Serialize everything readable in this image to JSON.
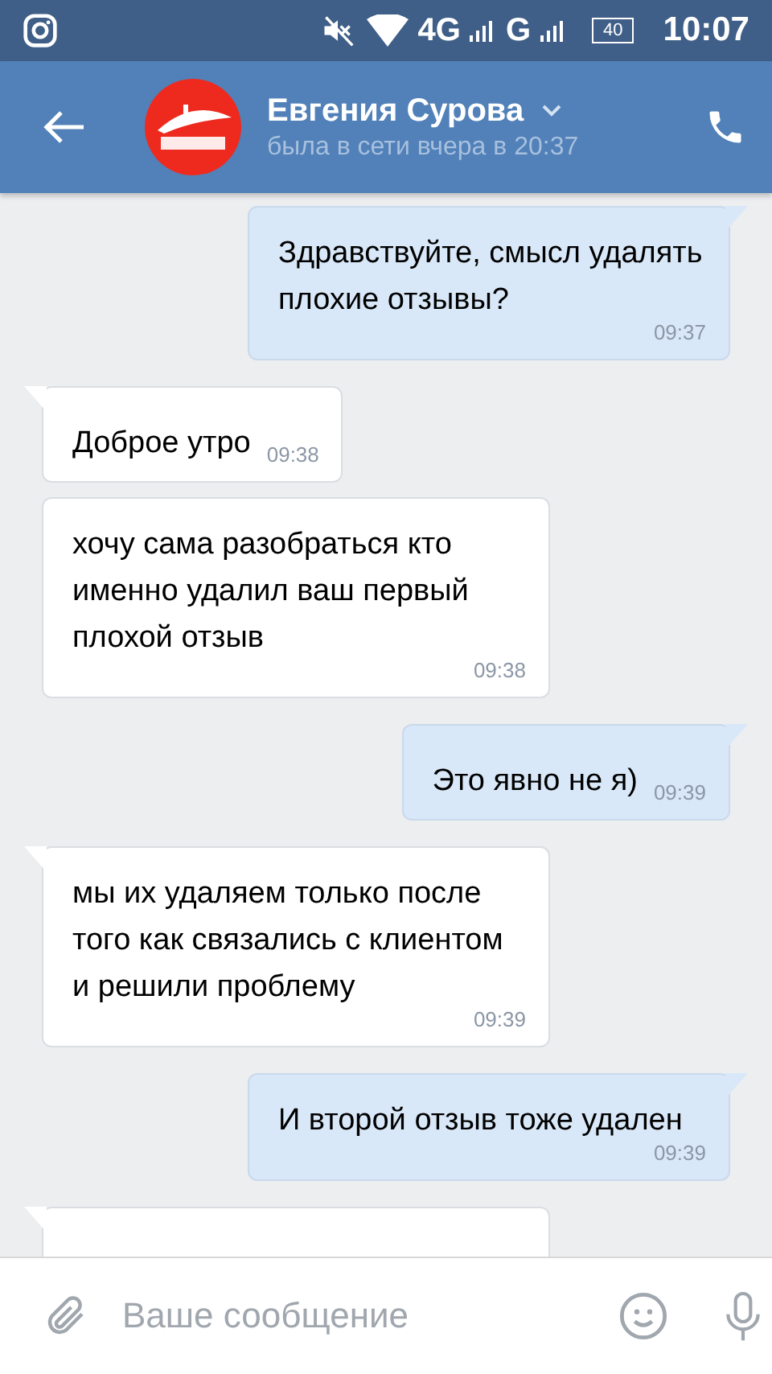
{
  "status_bar": {
    "network_1": "4G",
    "network_2": "G",
    "battery": "40",
    "time": "10:07"
  },
  "header": {
    "name": "Евгения Сурова",
    "status": "была в сети вчера в 20:37"
  },
  "messages": [
    {
      "kind": "out",
      "tail": true,
      "text": "Здравствуйте, смысл удалять плохие отзывы?",
      "time": "09:37"
    },
    {
      "kind": "in",
      "tail": true,
      "text": "Доброе утро",
      "time": "09:38"
    },
    {
      "kind": "in",
      "tail": false,
      "text": "хочу сама разобраться кто именно удалил ваш первый плохой отзыв",
      "time": "09:38"
    },
    {
      "kind": "out",
      "tail": true,
      "text": "Это явно не я)",
      "time": "09:39"
    },
    {
      "kind": "in",
      "tail": true,
      "text": "мы их удаляем только после того как связались с клиентом и решили проблему",
      "time": "09:39"
    },
    {
      "kind": "out",
      "tail": true,
      "text": "И второй отзыв тоже удален",
      "time": "09:39"
    },
    {
      "kind": "in",
      "tail": true
    }
  ],
  "composer": {
    "placeholder": "Ваше сообщение"
  }
}
